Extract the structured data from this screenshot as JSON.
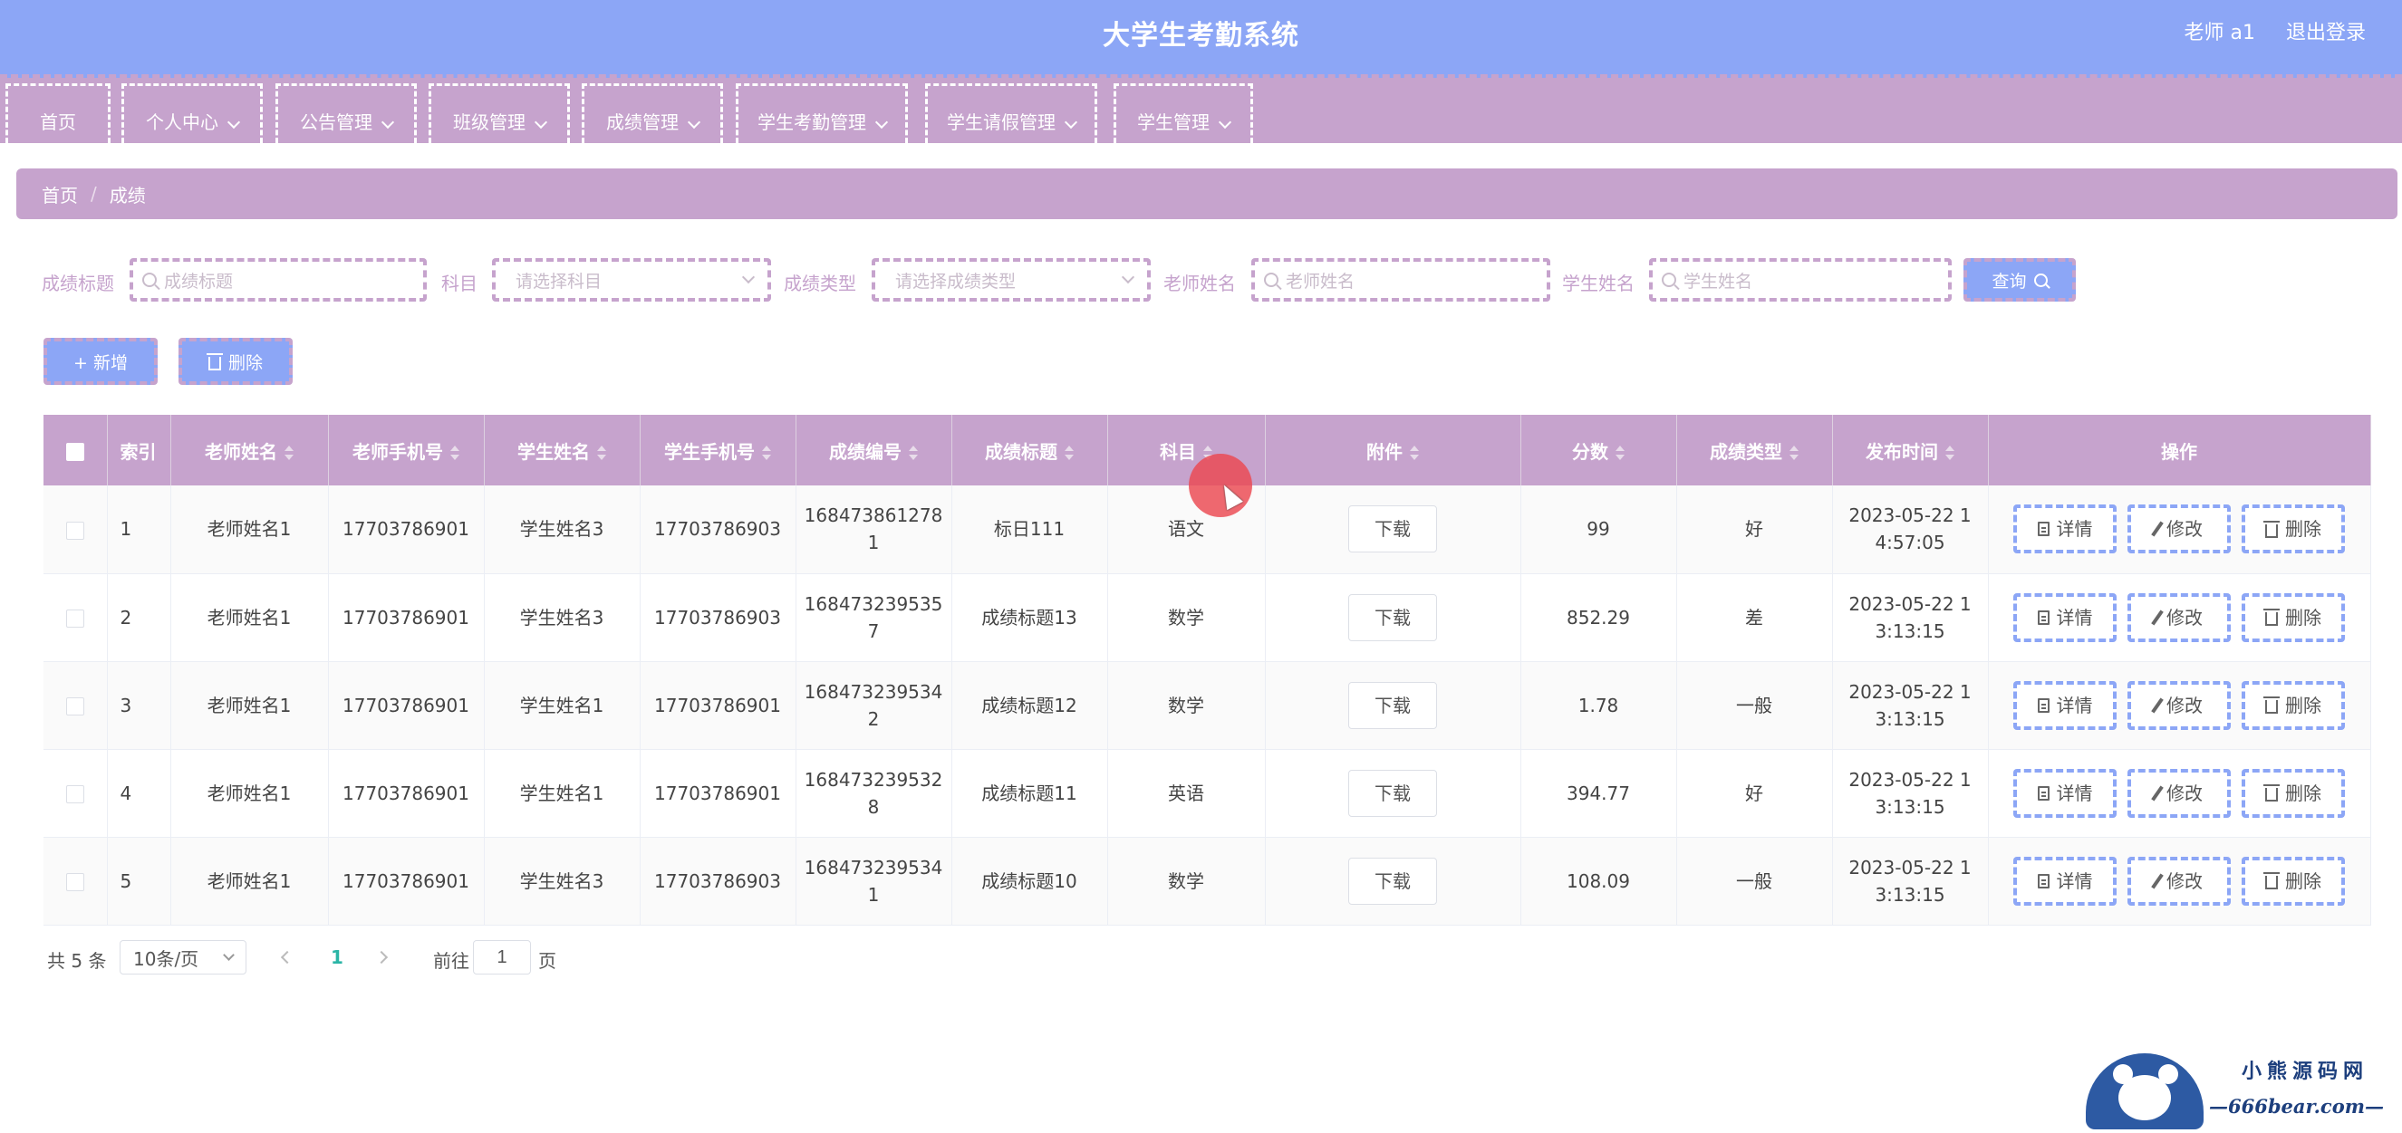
{
  "header": {
    "title": "大学生考勤系统",
    "user": "老师 a1",
    "logout": "退出登录"
  },
  "nav": [
    {
      "label": "首页",
      "dropdown": false
    },
    {
      "label": "个人中心",
      "dropdown": true
    },
    {
      "label": "公告管理",
      "dropdown": true
    },
    {
      "label": "班级管理",
      "dropdown": true
    },
    {
      "label": "成绩管理",
      "dropdown": true
    },
    {
      "label": "学生考勤管理",
      "dropdown": true
    },
    {
      "label": "学生请假管理",
      "dropdown": true
    },
    {
      "label": "学生管理",
      "dropdown": true
    }
  ],
  "breadcrumb": {
    "home": "首页",
    "sep": "/",
    "current": "成绩"
  },
  "search": {
    "title_label": "成绩标题",
    "title_placeholder": "成绩标题",
    "subject_label": "科目",
    "subject_placeholder": "请选择科目",
    "type_label": "成绩类型",
    "type_placeholder": "请选择成绩类型",
    "teacher_label": "老师姓名",
    "teacher_placeholder": "老师姓名",
    "student_label": "学生姓名",
    "student_placeholder": "学生姓名",
    "query_label": "查询"
  },
  "actions": {
    "add_label": "+ 新增",
    "delete_label": "删除"
  },
  "table": {
    "columns": [
      "索引",
      "老师姓名",
      "老师手机号",
      "学生姓名",
      "学生手机号",
      "成绩编号",
      "成绩标题",
      "科目",
      "附件",
      "分数",
      "成绩类型",
      "发布时间",
      "操作"
    ],
    "rows": [
      {
        "index": "1",
        "teacher": "老师姓名1",
        "teacher_phone": "17703786901",
        "student": "学生姓名3",
        "student_phone": "17703786903",
        "code_a": "168473861278",
        "code_b": "1",
        "title": "标日111",
        "subject": "语文",
        "attachment": "下载",
        "score": "99",
        "type": "好",
        "time_a": "2023-05-22 1",
        "time_b": "4:57:05"
      },
      {
        "index": "2",
        "teacher": "老师姓名1",
        "teacher_phone": "17703786901",
        "student": "学生姓名3",
        "student_phone": "17703786903",
        "code_a": "168473239535",
        "code_b": "7",
        "title": "成绩标题13",
        "subject": "数学",
        "attachment": "下载",
        "score": "852.29",
        "type": "差",
        "time_a": "2023-05-22 1",
        "time_b": "3:13:15"
      },
      {
        "index": "3",
        "teacher": "老师姓名1",
        "teacher_phone": "17703786901",
        "student": "学生姓名1",
        "student_phone": "17703786901",
        "code_a": "168473239534",
        "code_b": "2",
        "title": "成绩标题12",
        "subject": "数学",
        "attachment": "下载",
        "score": "1.78",
        "type": "一般",
        "time_a": "2023-05-22 1",
        "time_b": "3:13:15"
      },
      {
        "index": "4",
        "teacher": "老师姓名1",
        "teacher_phone": "17703786901",
        "student": "学生姓名1",
        "student_phone": "17703786901",
        "code_a": "168473239532",
        "code_b": "8",
        "title": "成绩标题11",
        "subject": "英语",
        "attachment": "下载",
        "score": "394.77",
        "type": "好",
        "time_a": "2023-05-22 1",
        "time_b": "3:13:15"
      },
      {
        "index": "5",
        "teacher": "老师姓名1",
        "teacher_phone": "17703786901",
        "student": "学生姓名3",
        "student_phone": "17703786903",
        "code_a": "168473239534",
        "code_b": "1",
        "title": "成绩标题10",
        "subject": "数学",
        "attachment": "下载",
        "score": "108.09",
        "type": "一般",
        "time_a": "2023-05-22 1",
        "time_b": "3:13:15"
      }
    ],
    "row_actions": {
      "detail": "详情",
      "edit": "修改",
      "delete": "删除"
    }
  },
  "pagination": {
    "total": "共 5 条",
    "page_size": "10条/页",
    "current_page": "1",
    "goto_prefix": "前往",
    "goto_value": "1",
    "goto_suffix": "页"
  },
  "watermark": {
    "brand": "小熊源码网",
    "url": "—666bear.com—"
  },
  "colors": {
    "header_bg": "#8ca6f6",
    "accent_purple": "#c6a3cd",
    "primary_blue": "#8ca6f6",
    "page_active": "#2bb5a6"
  }
}
